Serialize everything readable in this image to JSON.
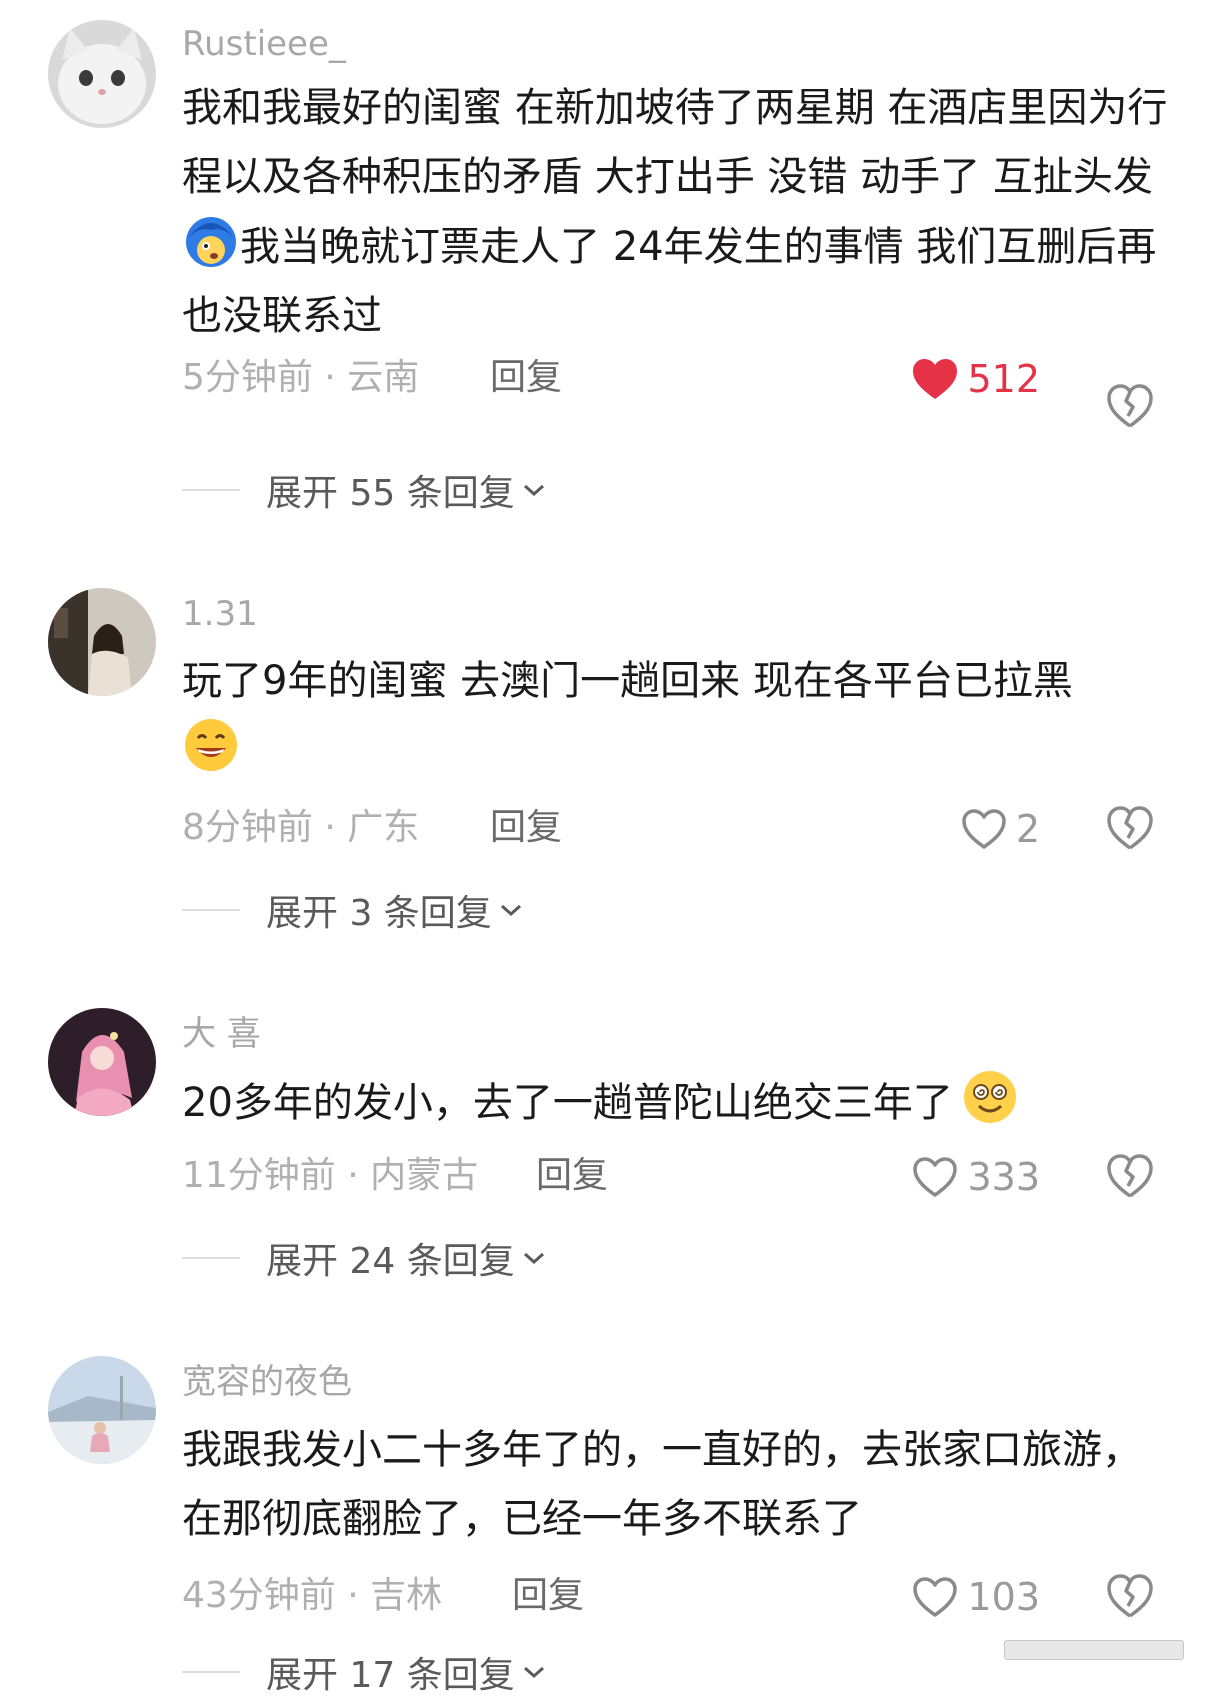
{
  "comments": [
    {
      "username": "Rustieee_",
      "text_part1": "我和我最好的闺蜜 在新加坡待了两星期 在酒店里因为行程以及各种积压的矛盾 大打出手 没错 动手了 互扯头发",
      "text_part2": "我当晚就订票走人了 24年发生的事情 我们互删后再也没联系过",
      "emoji": "shocked-emoji",
      "time_location": "5分钟前 · 云南",
      "reply_label": "回复",
      "likes": "512",
      "liked": true,
      "expand_label": "展开 55 条回复"
    },
    {
      "username": "1.31",
      "text_part1": "玩了9年的闺蜜 去澳门一趟回来 现在各平台已拉黑",
      "text_part2": "",
      "emoji": "grinning-emoji",
      "time_location": "8分钟前 · 广东",
      "reply_label": "回复",
      "likes": "2",
      "liked": false,
      "expand_label": "展开 3 条回复"
    },
    {
      "username": "大 喜",
      "text_part1": "20多年的发小，去了一趟普陀山绝交三年了",
      "text_part2": "",
      "emoji": "dizzy-emoji",
      "time_location": "11分钟前 · 内蒙古",
      "reply_label": "回复",
      "likes": "333",
      "liked": false,
      "expand_label": "展开 24 条回复"
    },
    {
      "username": "宽容的夜色",
      "text_part1": "我跟我发小二十多年了的，一直好的，去张家口旅游，在那彻底翻脸了，已经一年多不联系了",
      "text_part2": "",
      "emoji": "",
      "time_location": "43分钟前 · 吉林",
      "reply_label": "回复",
      "likes": "103",
      "liked": false,
      "expand_label": "展开 17 条回复"
    }
  ],
  "colors": {
    "like_active": "#e63247",
    "meta_text": "#b0b0b0",
    "body_text": "#1a1a1a"
  }
}
